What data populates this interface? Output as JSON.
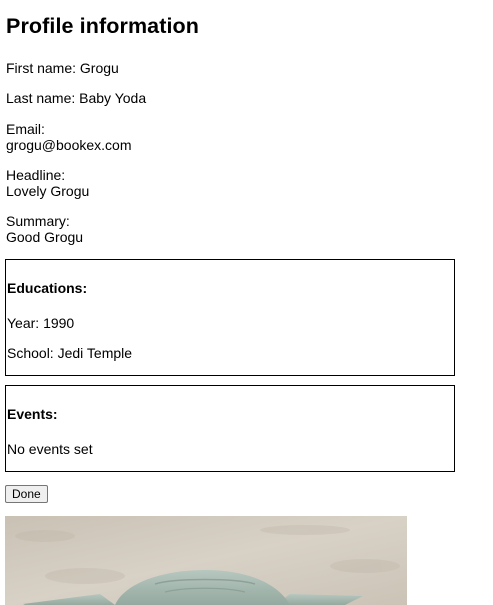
{
  "page_title": "Profile information",
  "profile": {
    "first_name": "First name: Grogu",
    "last_name": "Last name: Baby Yoda",
    "email_label": "Email:",
    "email_value": "grogu@bookex.com",
    "headline_label": "Headline:",
    "headline_value": "Lovely Grogu",
    "summary_label": "Summary:",
    "summary_value": "Good Grogu"
  },
  "educations": {
    "heading": "Educations:",
    "year": "Year: 1990",
    "school": "School: Jedi Temple"
  },
  "events": {
    "heading": "Events:",
    "empty_text": "No events set"
  },
  "done_label": "Done",
  "colors": {
    "border": "#000000",
    "button_bg": "#efefef",
    "sand": "#d2cbbf",
    "grogu_skin": "#a9bcb3"
  }
}
